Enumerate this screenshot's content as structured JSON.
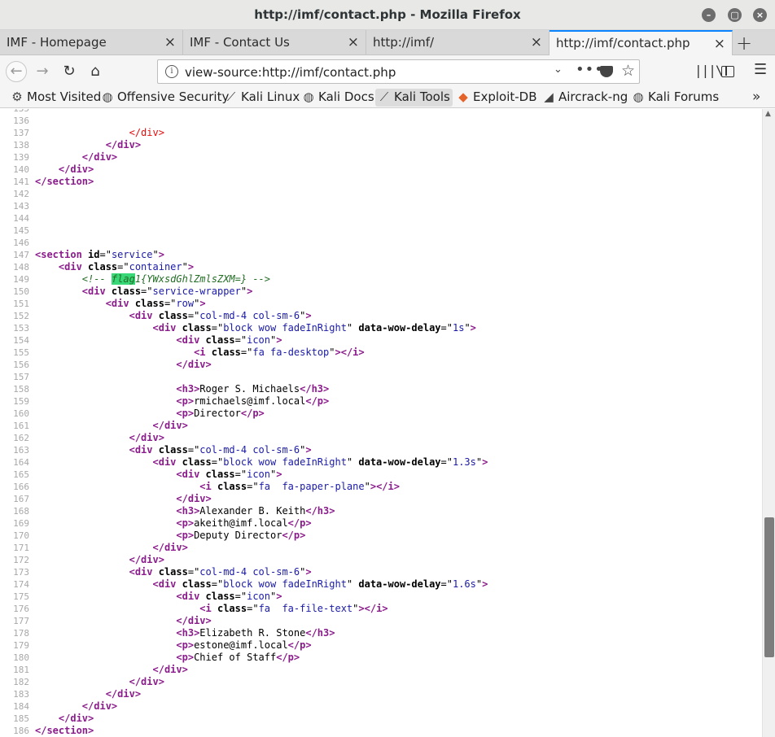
{
  "window": {
    "title": "http://imf/contact.php - Mozilla Firefox"
  },
  "tabs": [
    {
      "label": "IMF - Homepage",
      "active": false
    },
    {
      "label": "IMF - Contact Us",
      "active": false
    },
    {
      "label": "http://imf/",
      "active": false
    },
    {
      "label": "http://imf/contact.php",
      "active": true
    }
  ],
  "toolbar": {
    "url": "view-source:http://imf/contact.php",
    "icons": [
      "back-icon",
      "forward-icon",
      "reload-icon",
      "home-icon",
      "info-icon",
      "chevron-down-icon",
      "page-actions-icon",
      "pocket-icon",
      "bookmark-star-icon",
      "library-icon",
      "sidebar-icon",
      "menu-icon"
    ]
  },
  "bookmarks": [
    {
      "label": "Most Visited",
      "icon": "gear-icon"
    },
    {
      "label": "Offensive Security",
      "icon": "globe-icon"
    },
    {
      "label": "Kali Linux",
      "icon": "kali-icon"
    },
    {
      "label": "Kali Docs",
      "icon": "globe-icon"
    },
    {
      "label": "Kali Tools",
      "icon": "kali-icon",
      "active": true
    },
    {
      "label": "Exploit-DB",
      "icon": "exploitdb-icon"
    },
    {
      "label": "Aircrack-ng",
      "icon": "aircrack-icon"
    },
    {
      "label": "Kali Forums",
      "icon": "globe-icon"
    }
  ],
  "colors": {
    "tag": "#8b1c8c",
    "value": "#1a1aa6",
    "comment": "#236e25",
    "error": "#e50d0d",
    "highlight": "#38d878",
    "active_tab_accent": "#0a84ff"
  },
  "source": {
    "lines": [
      {
        "n": "135",
        "tokens": []
      },
      {
        "n": "136",
        "tokens": []
      },
      {
        "n": "137",
        "tokens": [
          {
            "t": "                ",
            "c": ""
          },
          {
            "t": "</div>",
            "c": "err"
          }
        ]
      },
      {
        "n": "138",
        "tokens": [
          {
            "t": "            ",
            "c": ""
          },
          {
            "t": "</div>",
            "c": "tag"
          }
        ]
      },
      {
        "n": "139",
        "tokens": [
          {
            "t": "        ",
            "c": ""
          },
          {
            "t": "</div>",
            "c": "tag"
          }
        ]
      },
      {
        "n": "140",
        "tokens": [
          {
            "t": "    ",
            "c": ""
          },
          {
            "t": "</div>",
            "c": "tag"
          }
        ]
      },
      {
        "n": "141",
        "tokens": [
          {
            "t": "</section>",
            "c": "tag"
          }
        ]
      },
      {
        "n": "142",
        "tokens": []
      },
      {
        "n": "143",
        "tokens": []
      },
      {
        "n": "144",
        "tokens": []
      },
      {
        "n": "145",
        "tokens": []
      },
      {
        "n": "146",
        "tokens": []
      },
      {
        "n": "147",
        "tokens": [
          {
            "t": "<section ",
            "c": "tag"
          },
          {
            "t": "id",
            "c": "attr"
          },
          {
            "t": "=\"",
            "c": ""
          },
          {
            "t": "service",
            "c": "val"
          },
          {
            "t": "\"",
            "c": ""
          },
          {
            "t": ">",
            "c": "tag"
          }
        ]
      },
      {
        "n": "148",
        "tokens": [
          {
            "t": "    ",
            "c": ""
          },
          {
            "t": "<div ",
            "c": "tag"
          },
          {
            "t": "class",
            "c": "attr"
          },
          {
            "t": "=\"",
            "c": ""
          },
          {
            "t": "container",
            "c": "val"
          },
          {
            "t": "\"",
            "c": ""
          },
          {
            "t": ">",
            "c": "tag"
          }
        ]
      },
      {
        "n": "149",
        "tokens": [
          {
            "t": "        ",
            "c": ""
          },
          {
            "t": "<!-- ",
            "c": "cmt"
          },
          {
            "t": "flag",
            "c": "cmt hl"
          },
          {
            "t": "1{YWxsdGhlZmlsZXM=} -->",
            "c": "cmt"
          }
        ]
      },
      {
        "n": "150",
        "tokens": [
          {
            "t": "        ",
            "c": ""
          },
          {
            "t": "<div ",
            "c": "tag"
          },
          {
            "t": "class",
            "c": "attr"
          },
          {
            "t": "=\"",
            "c": ""
          },
          {
            "t": "service-wrapper",
            "c": "val"
          },
          {
            "t": "\"",
            "c": ""
          },
          {
            "t": ">",
            "c": "tag"
          }
        ]
      },
      {
        "n": "151",
        "tokens": [
          {
            "t": "            ",
            "c": ""
          },
          {
            "t": "<div ",
            "c": "tag"
          },
          {
            "t": "class",
            "c": "attr"
          },
          {
            "t": "=\"",
            "c": ""
          },
          {
            "t": "row",
            "c": "val"
          },
          {
            "t": "\"",
            "c": ""
          },
          {
            "t": ">",
            "c": "tag"
          }
        ]
      },
      {
        "n": "152",
        "tokens": [
          {
            "t": "                ",
            "c": ""
          },
          {
            "t": "<div ",
            "c": "tag"
          },
          {
            "t": "class",
            "c": "attr"
          },
          {
            "t": "=\"",
            "c": ""
          },
          {
            "t": "col-md-4 col-sm-6",
            "c": "val"
          },
          {
            "t": "\"",
            "c": ""
          },
          {
            "t": ">",
            "c": "tag"
          }
        ]
      },
      {
        "n": "153",
        "tokens": [
          {
            "t": "                    ",
            "c": ""
          },
          {
            "t": "<div ",
            "c": "tag"
          },
          {
            "t": "class",
            "c": "attr"
          },
          {
            "t": "=\"",
            "c": ""
          },
          {
            "t": "block wow fadeInRight",
            "c": "val"
          },
          {
            "t": "\" ",
            "c": ""
          },
          {
            "t": "data-wow-delay",
            "c": "attr"
          },
          {
            "t": "=\"",
            "c": ""
          },
          {
            "t": "1s",
            "c": "val"
          },
          {
            "t": "\"",
            "c": ""
          },
          {
            "t": ">",
            "c": "tag"
          }
        ]
      },
      {
        "n": "154",
        "tokens": [
          {
            "t": "                        ",
            "c": ""
          },
          {
            "t": "<div ",
            "c": "tag"
          },
          {
            "t": "class",
            "c": "attr"
          },
          {
            "t": "=\"",
            "c": ""
          },
          {
            "t": "icon",
            "c": "val"
          },
          {
            "t": "\"",
            "c": ""
          },
          {
            "t": ">",
            "c": "tag"
          }
        ]
      },
      {
        "n": "155",
        "tokens": [
          {
            "t": "                           ",
            "c": ""
          },
          {
            "t": "<i ",
            "c": "tag"
          },
          {
            "t": "class",
            "c": "attr"
          },
          {
            "t": "=\"",
            "c": ""
          },
          {
            "t": "fa fa-desktop",
            "c": "val"
          },
          {
            "t": "\"",
            "c": ""
          },
          {
            "t": "></i>",
            "c": "tag"
          }
        ]
      },
      {
        "n": "156",
        "tokens": [
          {
            "t": "                        ",
            "c": ""
          },
          {
            "t": "</div>",
            "c": "tag"
          }
        ]
      },
      {
        "n": "157",
        "tokens": []
      },
      {
        "n": "158",
        "tokens": [
          {
            "t": "                        ",
            "c": ""
          },
          {
            "t": "<h3>",
            "c": "tag"
          },
          {
            "t": "Roger S. Michaels",
            "c": ""
          },
          {
            "t": "</h3>",
            "c": "tag"
          }
        ]
      },
      {
        "n": "159",
        "tokens": [
          {
            "t": "                        ",
            "c": ""
          },
          {
            "t": "<p>",
            "c": "tag"
          },
          {
            "t": "rmichaels@imf.local",
            "c": ""
          },
          {
            "t": "</p>",
            "c": "tag"
          }
        ]
      },
      {
        "n": "160",
        "tokens": [
          {
            "t": "                        ",
            "c": ""
          },
          {
            "t": "<p>",
            "c": "tag"
          },
          {
            "t": "Director",
            "c": ""
          },
          {
            "t": "</p>",
            "c": "tag"
          }
        ]
      },
      {
        "n": "161",
        "tokens": [
          {
            "t": "                    ",
            "c": ""
          },
          {
            "t": "</div>",
            "c": "tag"
          }
        ]
      },
      {
        "n": "162",
        "tokens": [
          {
            "t": "                ",
            "c": ""
          },
          {
            "t": "</div>",
            "c": "tag"
          }
        ]
      },
      {
        "n": "163",
        "tokens": [
          {
            "t": "                ",
            "c": ""
          },
          {
            "t": "<div ",
            "c": "tag"
          },
          {
            "t": "class",
            "c": "attr"
          },
          {
            "t": "=\"",
            "c": ""
          },
          {
            "t": "col-md-4 col-sm-6",
            "c": "val"
          },
          {
            "t": "\"",
            "c": ""
          },
          {
            "t": ">",
            "c": "tag"
          }
        ]
      },
      {
        "n": "164",
        "tokens": [
          {
            "t": "                    ",
            "c": ""
          },
          {
            "t": "<div ",
            "c": "tag"
          },
          {
            "t": "class",
            "c": "attr"
          },
          {
            "t": "=\"",
            "c": ""
          },
          {
            "t": "block wow fadeInRight",
            "c": "val"
          },
          {
            "t": "\" ",
            "c": ""
          },
          {
            "t": "data-wow-delay",
            "c": "attr"
          },
          {
            "t": "=\"",
            "c": ""
          },
          {
            "t": "1.3s",
            "c": "val"
          },
          {
            "t": "\"",
            "c": ""
          },
          {
            "t": ">",
            "c": "tag"
          }
        ]
      },
      {
        "n": "165",
        "tokens": [
          {
            "t": "                        ",
            "c": ""
          },
          {
            "t": "<div ",
            "c": "tag"
          },
          {
            "t": "class",
            "c": "attr"
          },
          {
            "t": "=\"",
            "c": ""
          },
          {
            "t": "icon",
            "c": "val"
          },
          {
            "t": "\"",
            "c": ""
          },
          {
            "t": ">",
            "c": "tag"
          }
        ]
      },
      {
        "n": "166",
        "tokens": [
          {
            "t": "                            ",
            "c": ""
          },
          {
            "t": "<i ",
            "c": "tag"
          },
          {
            "t": "class",
            "c": "attr"
          },
          {
            "t": "=\"",
            "c": ""
          },
          {
            "t": "fa  fa-paper-plane",
            "c": "val"
          },
          {
            "t": "\"",
            "c": ""
          },
          {
            "t": "></i>",
            "c": "tag"
          }
        ]
      },
      {
        "n": "167",
        "tokens": [
          {
            "t": "                        ",
            "c": ""
          },
          {
            "t": "</div>",
            "c": "tag"
          }
        ]
      },
      {
        "n": "168",
        "tokens": [
          {
            "t": "                        ",
            "c": ""
          },
          {
            "t": "<h3>",
            "c": "tag"
          },
          {
            "t": "Alexander B. Keith",
            "c": ""
          },
          {
            "t": "</h3>",
            "c": "tag"
          }
        ]
      },
      {
        "n": "169",
        "tokens": [
          {
            "t": "                        ",
            "c": ""
          },
          {
            "t": "<p>",
            "c": "tag"
          },
          {
            "t": "akeith@imf.local",
            "c": ""
          },
          {
            "t": "</p>",
            "c": "tag"
          }
        ]
      },
      {
        "n": "170",
        "tokens": [
          {
            "t": "                        ",
            "c": ""
          },
          {
            "t": "<p>",
            "c": "tag"
          },
          {
            "t": "Deputy Director",
            "c": ""
          },
          {
            "t": "</p>",
            "c": "tag"
          }
        ]
      },
      {
        "n": "171",
        "tokens": [
          {
            "t": "                    ",
            "c": ""
          },
          {
            "t": "</div>",
            "c": "tag"
          }
        ]
      },
      {
        "n": "172",
        "tokens": [
          {
            "t": "                ",
            "c": ""
          },
          {
            "t": "</div>",
            "c": "tag"
          }
        ]
      },
      {
        "n": "173",
        "tokens": [
          {
            "t": "                ",
            "c": ""
          },
          {
            "t": "<div ",
            "c": "tag"
          },
          {
            "t": "class",
            "c": "attr"
          },
          {
            "t": "=\"",
            "c": ""
          },
          {
            "t": "col-md-4 col-sm-6",
            "c": "val"
          },
          {
            "t": "\"",
            "c": ""
          },
          {
            "t": ">",
            "c": "tag"
          }
        ]
      },
      {
        "n": "174",
        "tokens": [
          {
            "t": "                    ",
            "c": ""
          },
          {
            "t": "<div ",
            "c": "tag"
          },
          {
            "t": "class",
            "c": "attr"
          },
          {
            "t": "=\"",
            "c": ""
          },
          {
            "t": "block wow fadeInRight",
            "c": "val"
          },
          {
            "t": "\" ",
            "c": ""
          },
          {
            "t": "data-wow-delay",
            "c": "attr"
          },
          {
            "t": "=\"",
            "c": ""
          },
          {
            "t": "1.6s",
            "c": "val"
          },
          {
            "t": "\"",
            "c": ""
          },
          {
            "t": ">",
            "c": "tag"
          }
        ]
      },
      {
        "n": "175",
        "tokens": [
          {
            "t": "                        ",
            "c": ""
          },
          {
            "t": "<div ",
            "c": "tag"
          },
          {
            "t": "class",
            "c": "attr"
          },
          {
            "t": "=\"",
            "c": ""
          },
          {
            "t": "icon",
            "c": "val"
          },
          {
            "t": "\"",
            "c": ""
          },
          {
            "t": ">",
            "c": "tag"
          }
        ]
      },
      {
        "n": "176",
        "tokens": [
          {
            "t": "                            ",
            "c": ""
          },
          {
            "t": "<i ",
            "c": "tag"
          },
          {
            "t": "class",
            "c": "attr"
          },
          {
            "t": "=\"",
            "c": ""
          },
          {
            "t": "fa  fa-file-text",
            "c": "val"
          },
          {
            "t": "\"",
            "c": ""
          },
          {
            "t": "></i>",
            "c": "tag"
          }
        ]
      },
      {
        "n": "177",
        "tokens": [
          {
            "t": "                        ",
            "c": ""
          },
          {
            "t": "</div>",
            "c": "tag"
          }
        ]
      },
      {
        "n": "178",
        "tokens": [
          {
            "t": "                        ",
            "c": ""
          },
          {
            "t": "<h3>",
            "c": "tag"
          },
          {
            "t": "Elizabeth R. Stone",
            "c": ""
          },
          {
            "t": "</h3>",
            "c": "tag"
          }
        ]
      },
      {
        "n": "179",
        "tokens": [
          {
            "t": "                        ",
            "c": ""
          },
          {
            "t": "<p>",
            "c": "tag"
          },
          {
            "t": "estone@imf.local",
            "c": ""
          },
          {
            "t": "</p>",
            "c": "tag"
          }
        ]
      },
      {
        "n": "180",
        "tokens": [
          {
            "t": "                        ",
            "c": ""
          },
          {
            "t": "<p>",
            "c": "tag"
          },
          {
            "t": "Chief of Staff",
            "c": ""
          },
          {
            "t": "</p>",
            "c": "tag"
          }
        ]
      },
      {
        "n": "181",
        "tokens": [
          {
            "t": "                    ",
            "c": ""
          },
          {
            "t": "</div>",
            "c": "tag"
          }
        ]
      },
      {
        "n": "182",
        "tokens": [
          {
            "t": "                ",
            "c": ""
          },
          {
            "t": "</div>",
            "c": "tag"
          }
        ]
      },
      {
        "n": "183",
        "tokens": [
          {
            "t": "            ",
            "c": ""
          },
          {
            "t": "</div>",
            "c": "tag"
          }
        ]
      },
      {
        "n": "184",
        "tokens": [
          {
            "t": "        ",
            "c": ""
          },
          {
            "t": "</div>",
            "c": "tag"
          }
        ]
      },
      {
        "n": "185",
        "tokens": [
          {
            "t": "    ",
            "c": ""
          },
          {
            "t": "</div>",
            "c": "tag"
          }
        ]
      },
      {
        "n": "186",
        "tokens": [
          {
            "t": "</section>",
            "c": "tag"
          }
        ]
      }
    ]
  }
}
